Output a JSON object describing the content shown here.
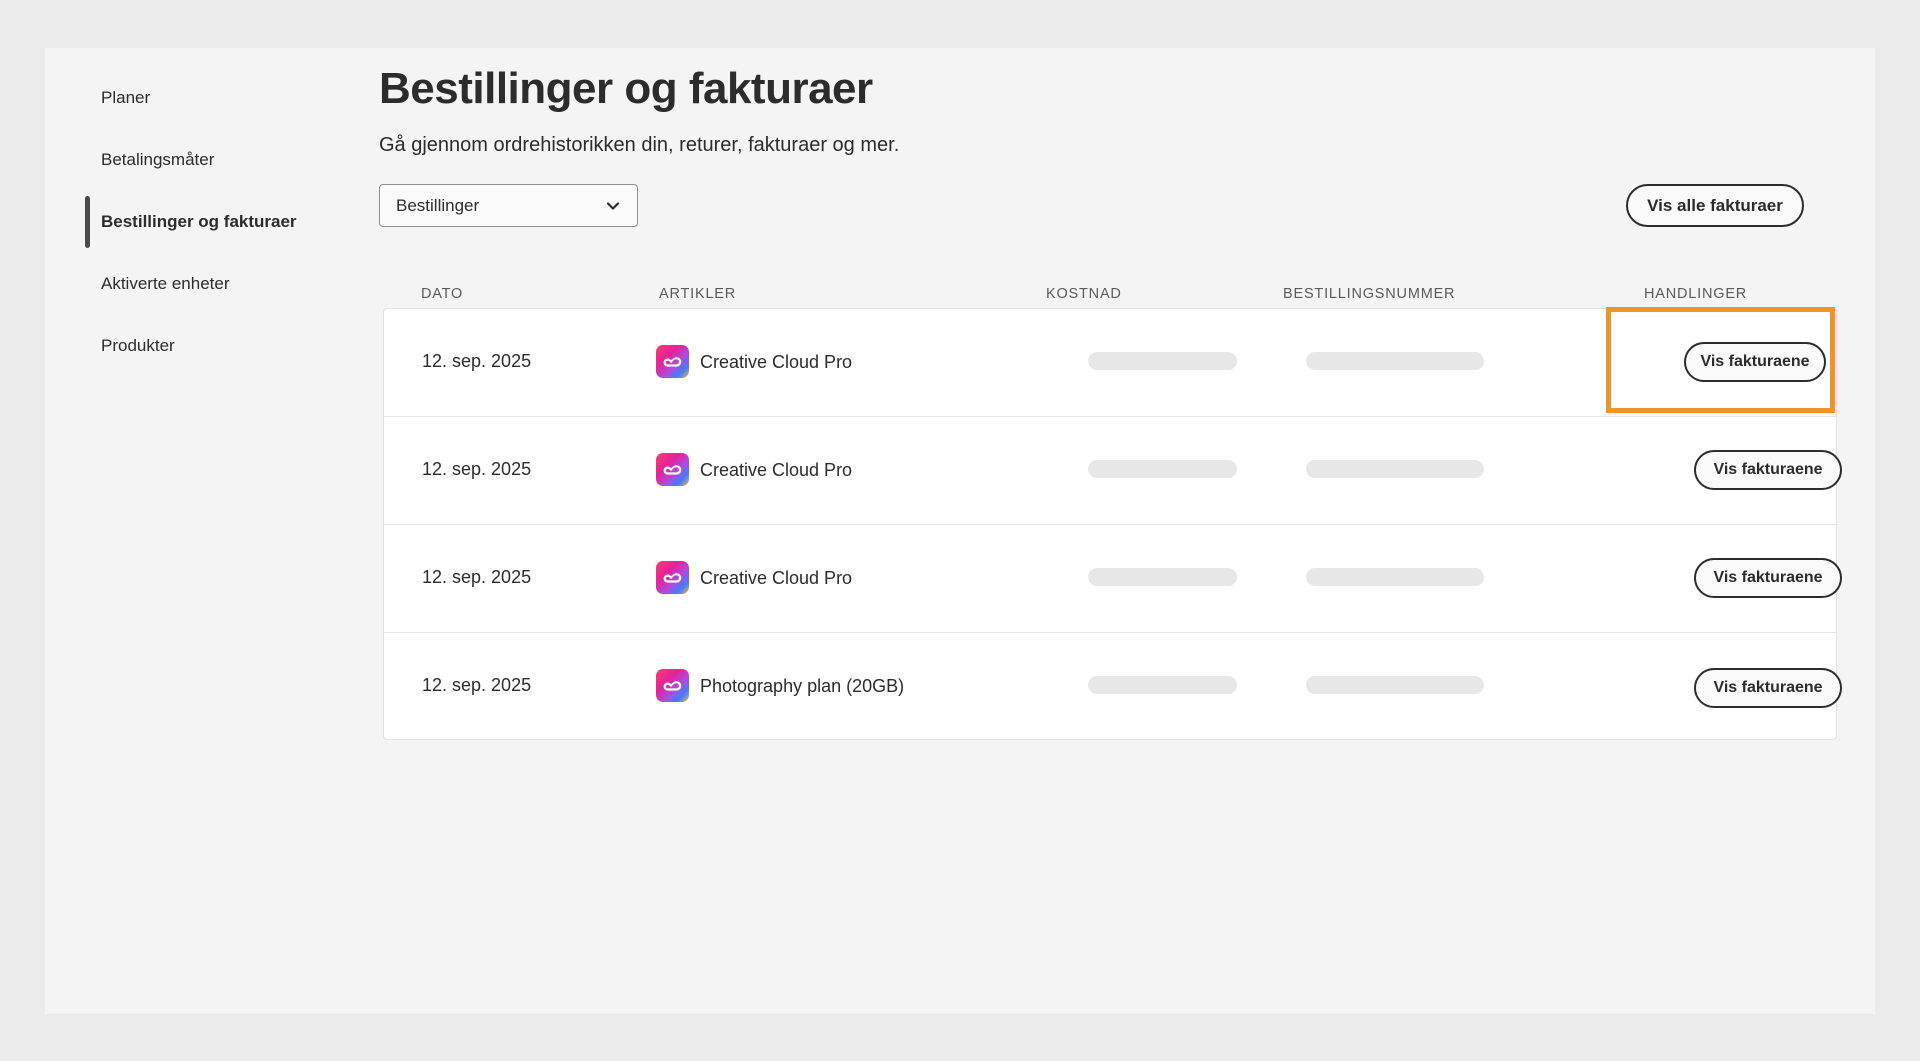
{
  "sidebar": {
    "items": [
      {
        "label": "Planer",
        "active": false
      },
      {
        "label": "Betalingsmåter",
        "active": false
      },
      {
        "label": "Bestillinger og fakturaer",
        "active": true
      },
      {
        "label": "Aktiverte enheter",
        "active": false
      },
      {
        "label": "Produkter",
        "active": false
      }
    ]
  },
  "header": {
    "title": "Bestillinger og fakturaer",
    "subtitle": "Gå gjennom ordrehistorikken din, returer, fakturaer og mer."
  },
  "filter": {
    "selected": "Bestillinger",
    "icon": "chevron-down-icon"
  },
  "toolbar": {
    "view_all_label": "Vis alle fakturaer"
  },
  "table": {
    "headers": [
      "DATO",
      "ARTIKLER",
      "KOSTNAD",
      "BESTILLINGSNUMMER",
      "HANDLINGER"
    ],
    "rows": [
      {
        "date": "12. sep. 2025",
        "article": "Creative Cloud Pro",
        "action": "Vis fakturaene"
      },
      {
        "date": "12. sep. 2025",
        "article": "Creative Cloud Pro",
        "action": "Vis fakturaene"
      },
      {
        "date": "12. sep. 2025",
        "article": "Creative Cloud Pro",
        "action": "Vis fakturaene"
      },
      {
        "date": "12. sep. 2025",
        "article": "Photography plan (20GB)",
        "action": "Vis fakturaene"
      }
    ]
  },
  "colors": {
    "highlight": "#f0932b",
    "text": "#2c2c2c"
  }
}
